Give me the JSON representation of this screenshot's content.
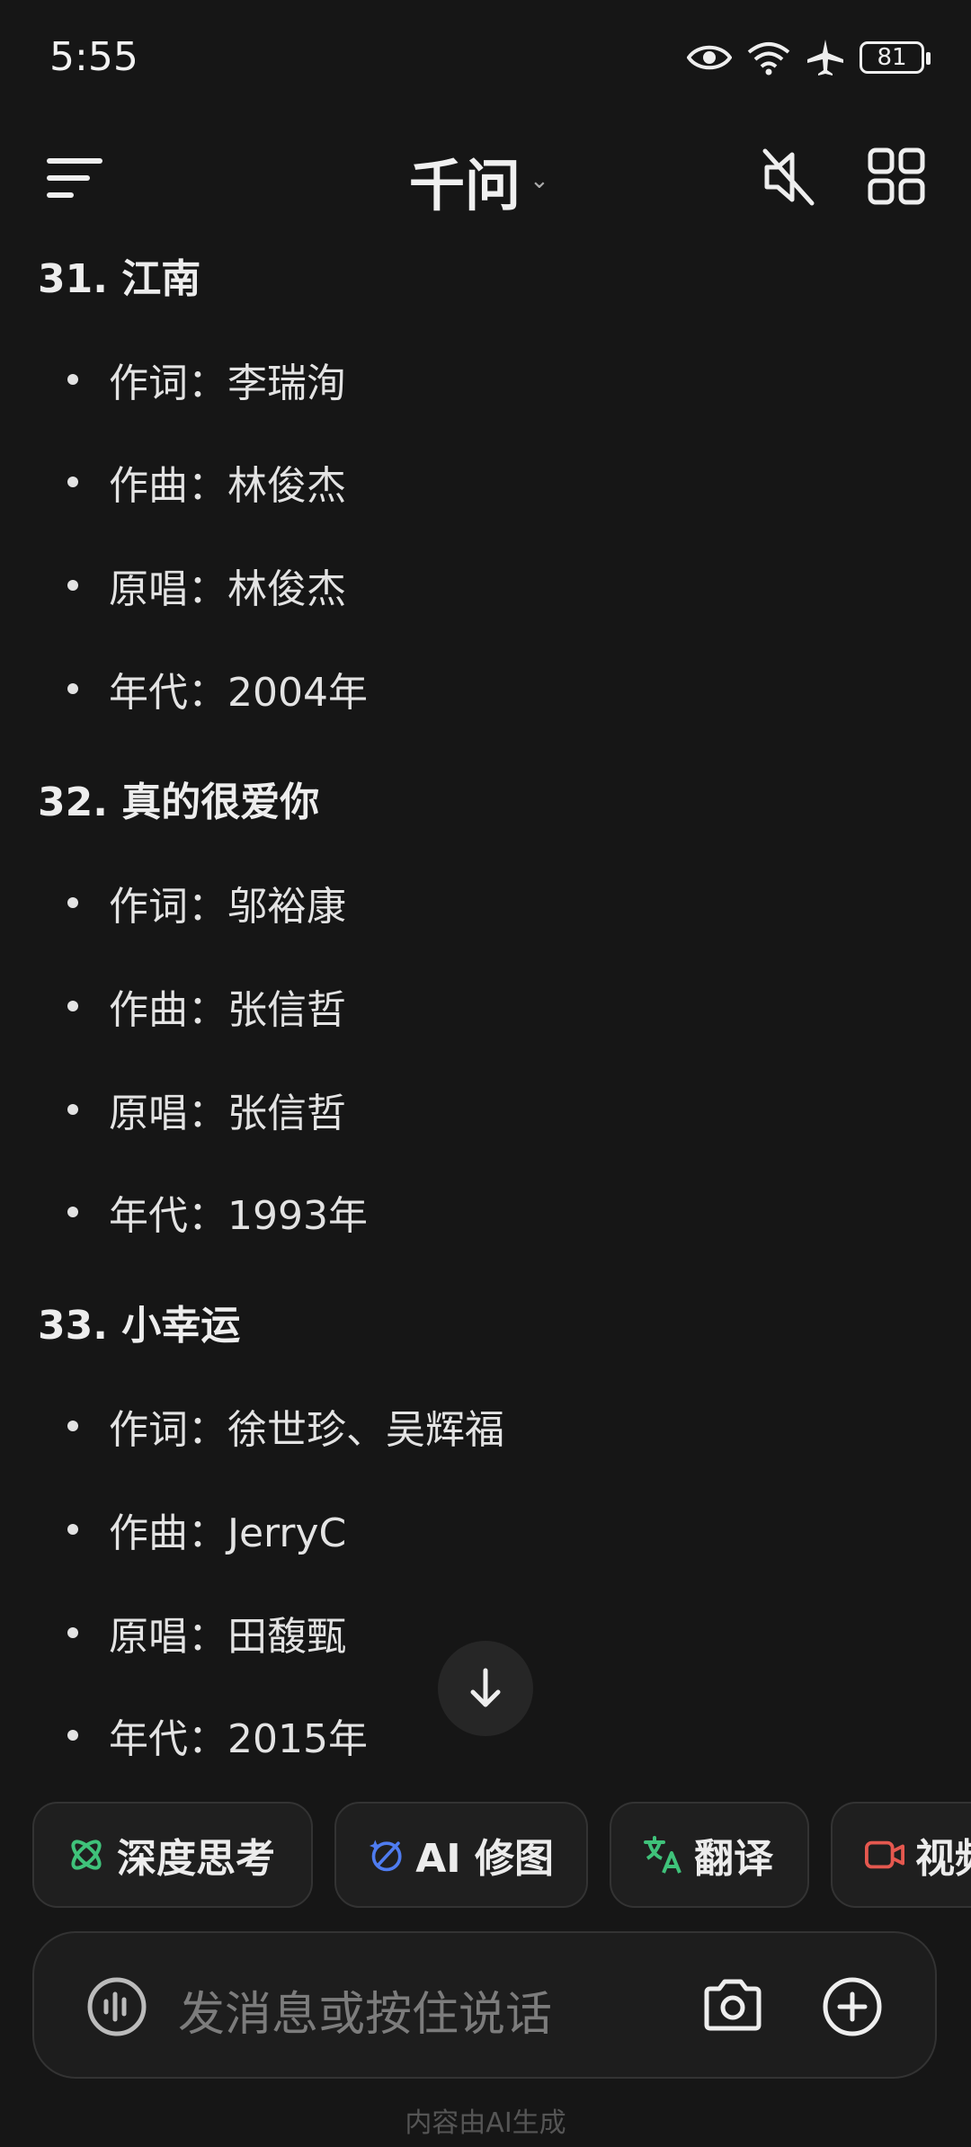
{
  "status_bar": {
    "time": "5:55",
    "battery": "81"
  },
  "app_bar": {
    "title": "千问"
  },
  "sections": [
    {
      "heading": "31. 江南",
      "items": [
        "作词：李瑞洵",
        "作曲：林俊杰",
        "原唱：林俊杰",
        "年代：2004年"
      ]
    },
    {
      "heading": "32. 真的很爱你",
      "items": [
        "作词：邬裕康",
        "作曲：张信哲",
        "原唱：张信哲",
        "年代：1993年"
      ]
    },
    {
      "heading": "33. 小幸运",
      "items": [
        "作词：徐世珍、吴辉福",
        "作曲：JerryC",
        "原唱：田馥甄",
        "年代：2015年"
      ]
    }
  ],
  "chips": [
    {
      "label": "深度思考",
      "icon": "atom-icon",
      "color": "#3fc27a"
    },
    {
      "label": "AI 修图",
      "icon": "magic-wand-icon",
      "color": "#4f7cf0"
    },
    {
      "label": "翻译",
      "icon": "translate-icon",
      "color": "#3fc27a"
    },
    {
      "label": "视频",
      "icon": "video-icon",
      "color": "#e5584f"
    }
  ],
  "composer": {
    "placeholder": "发消息或按住说话"
  },
  "footer": {
    "disclaimer": "内容由AI生成"
  }
}
